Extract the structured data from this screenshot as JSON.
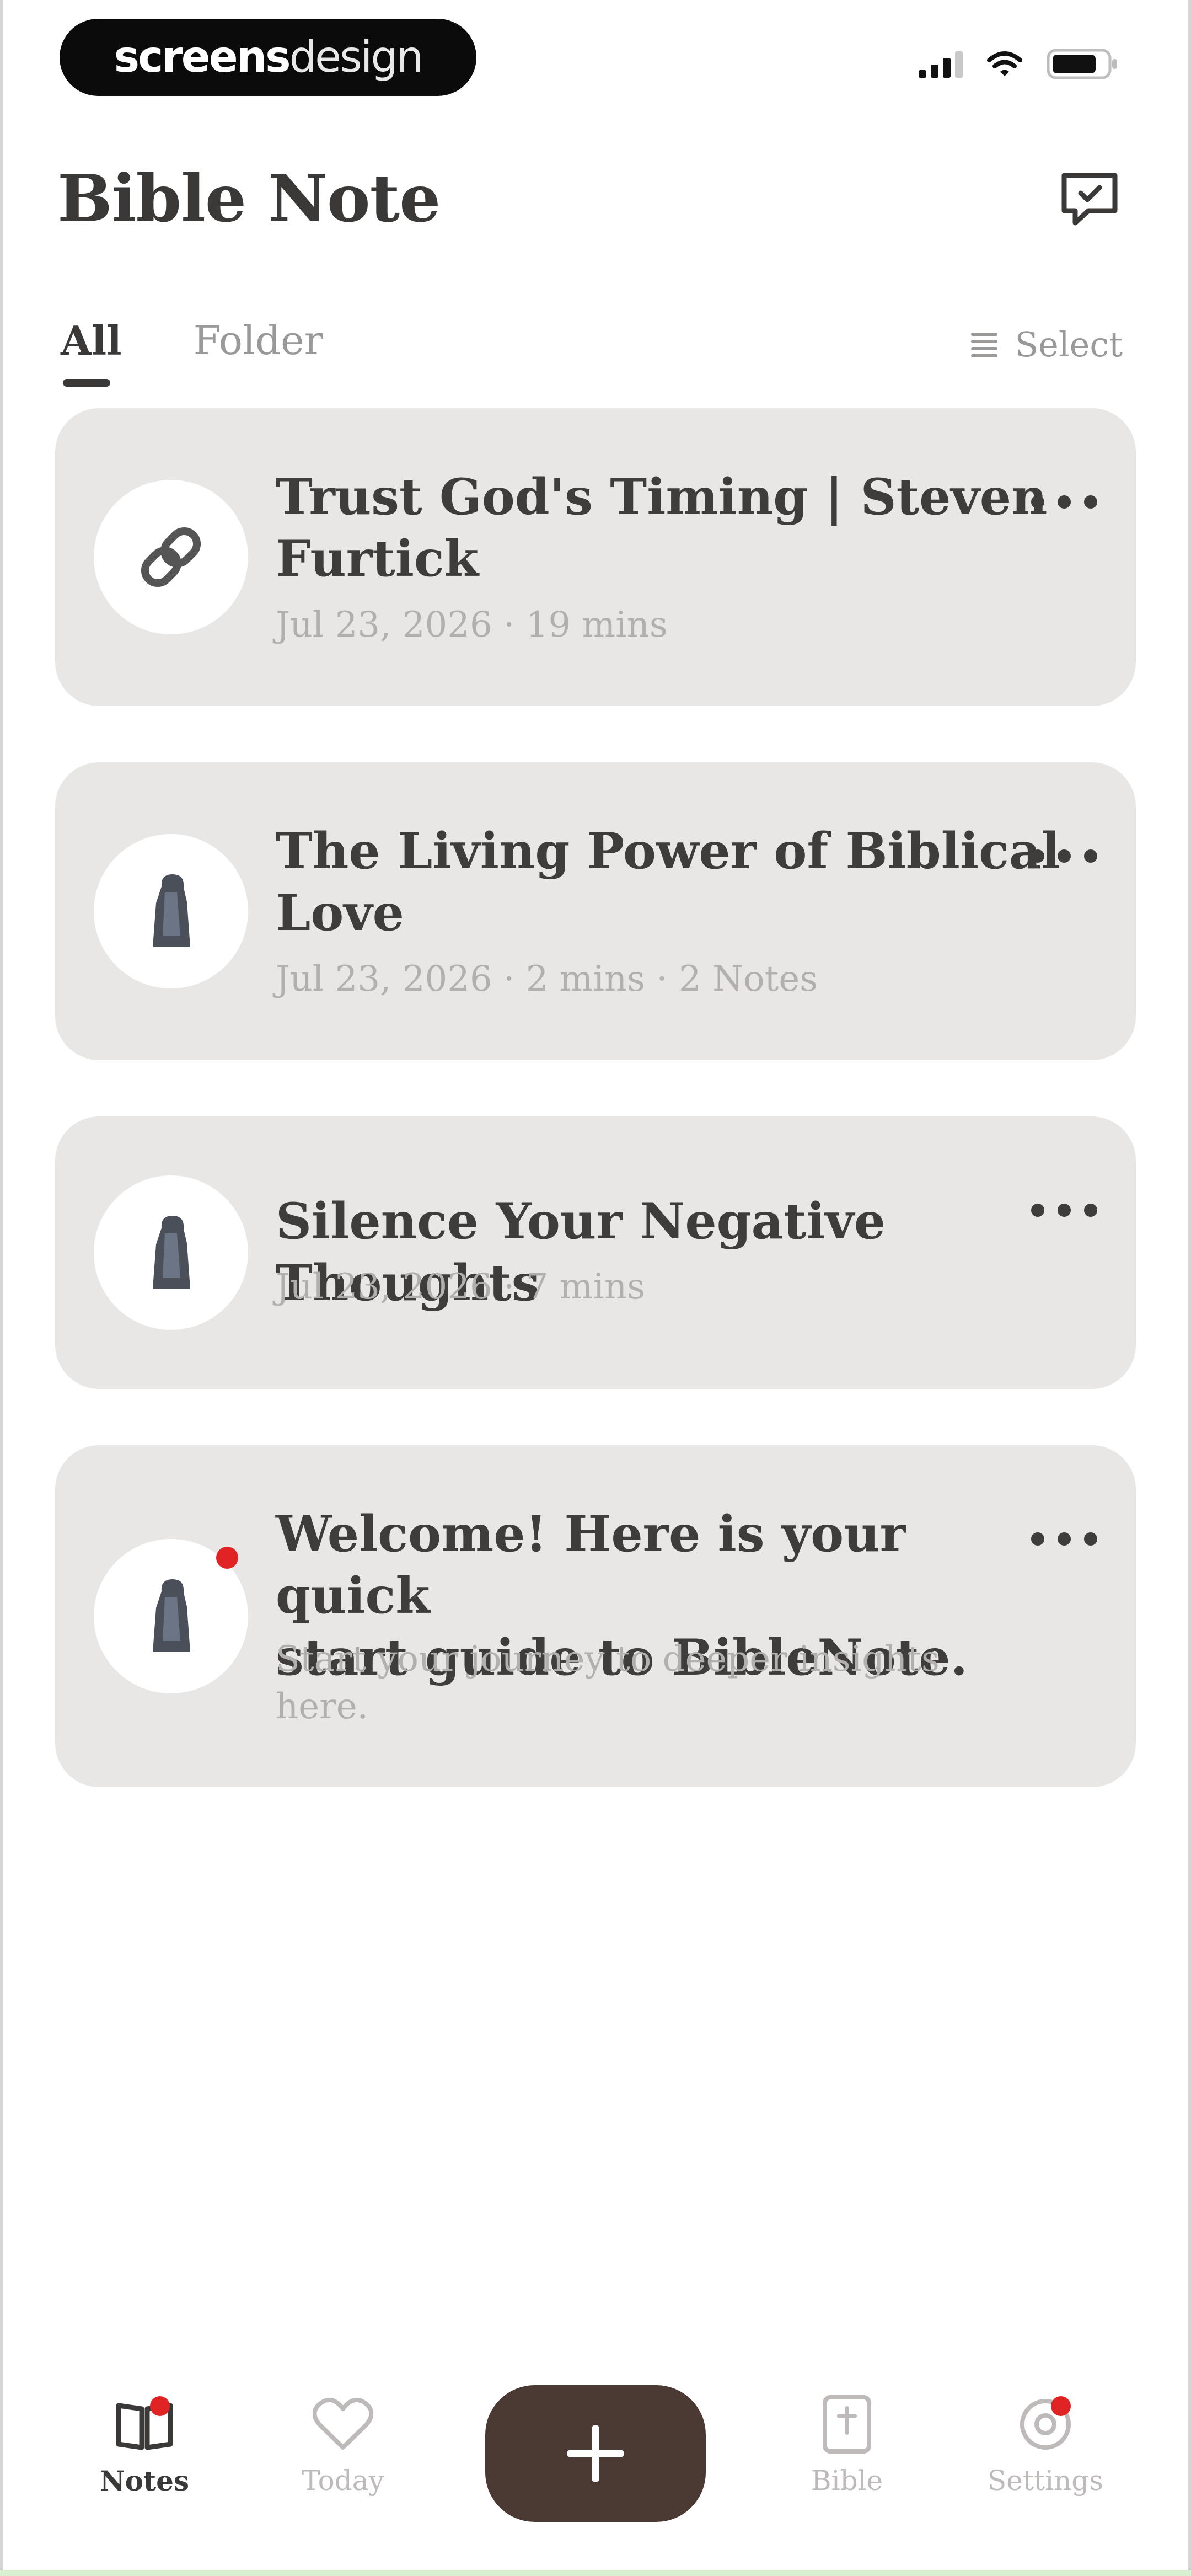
{
  "status_bar": {
    "brand_bold": "screens",
    "brand_light": "design"
  },
  "header": {
    "title": "Bible Note"
  },
  "tabs": [
    {
      "label": "All"
    },
    {
      "label": "Folder"
    }
  ],
  "select_label": "Select",
  "notes": [
    {
      "title_line1": "Trust God's Timing | Steven",
      "title_line2": "Furtick",
      "meta": "Jul 23, 2026 · 19 mins",
      "icon": "link-icon"
    },
    {
      "title_line1": "The Living Power of Biblical",
      "title_line2": "Love",
      "meta": "Jul 23, 2026 · 2 mins · 2 Notes",
      "icon": "figure-icon"
    },
    {
      "title_line1": "Silence Your Negative Thoughts",
      "meta": "Jul 23, 2026 · 7 mins",
      "icon": "figure-icon"
    },
    {
      "title_line1": "Welcome! Here is your quick",
      "title_line2": "start guide to BibleNote.",
      "meta_line1": "Start your journey to deeper insights",
      "meta_line2": "here.",
      "icon": "figure-icon",
      "unread": true
    }
  ],
  "bottom_nav": [
    {
      "label": "Notes",
      "icon": "notes-icon",
      "active": true
    },
    {
      "label": "Today",
      "icon": "heart-icon"
    },
    {
      "label": "Bible",
      "icon": "bible-icon"
    },
    {
      "label": "Settings",
      "icon": "settings-icon"
    }
  ],
  "colors": {
    "card_bg": "#e8e7e6",
    "add_button": "#4b3a33",
    "badge": "#e02424",
    "title_text": "#3b3838",
    "muted_text": "#b3afae"
  }
}
